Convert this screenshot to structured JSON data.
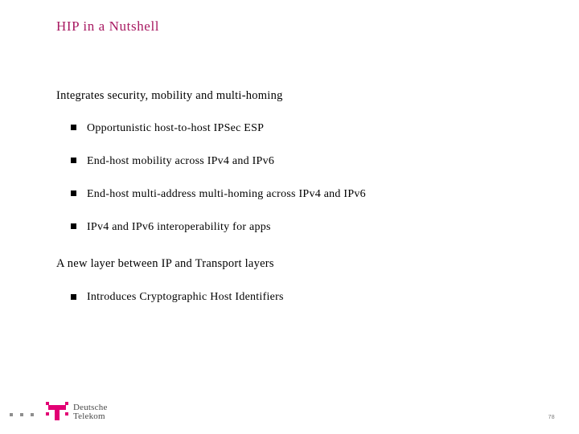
{
  "slide": {
    "title": "HIP in a Nutshell",
    "title_color": "#a81a62",
    "background_color": "#ffffff",
    "text_color": "#000000",
    "page_number": "78"
  },
  "sections": [
    {
      "heading": "Integrates security, mobility and multi-homing",
      "bullets": [
        "Opportunistic host-to-host IPSec ESP",
        "End-host mobility across IPv4 and IPv6",
        "End-host multi-address multi-homing across IPv4 and IPv6",
        "IPv4 and IPv6 interoperability for apps"
      ]
    },
    {
      "heading": "A new layer between IP and Transport layers",
      "bullets": [
        "Introduces Cryptographic Host Identifiers"
      ]
    }
  ],
  "footer": {
    "logo": {
      "brand_line_1": "Deutsche",
      "brand_line_2": "Telekom",
      "mark_color": "#e20074",
      "dot_color": "#8e8e8e",
      "dot_count": 3
    }
  }
}
